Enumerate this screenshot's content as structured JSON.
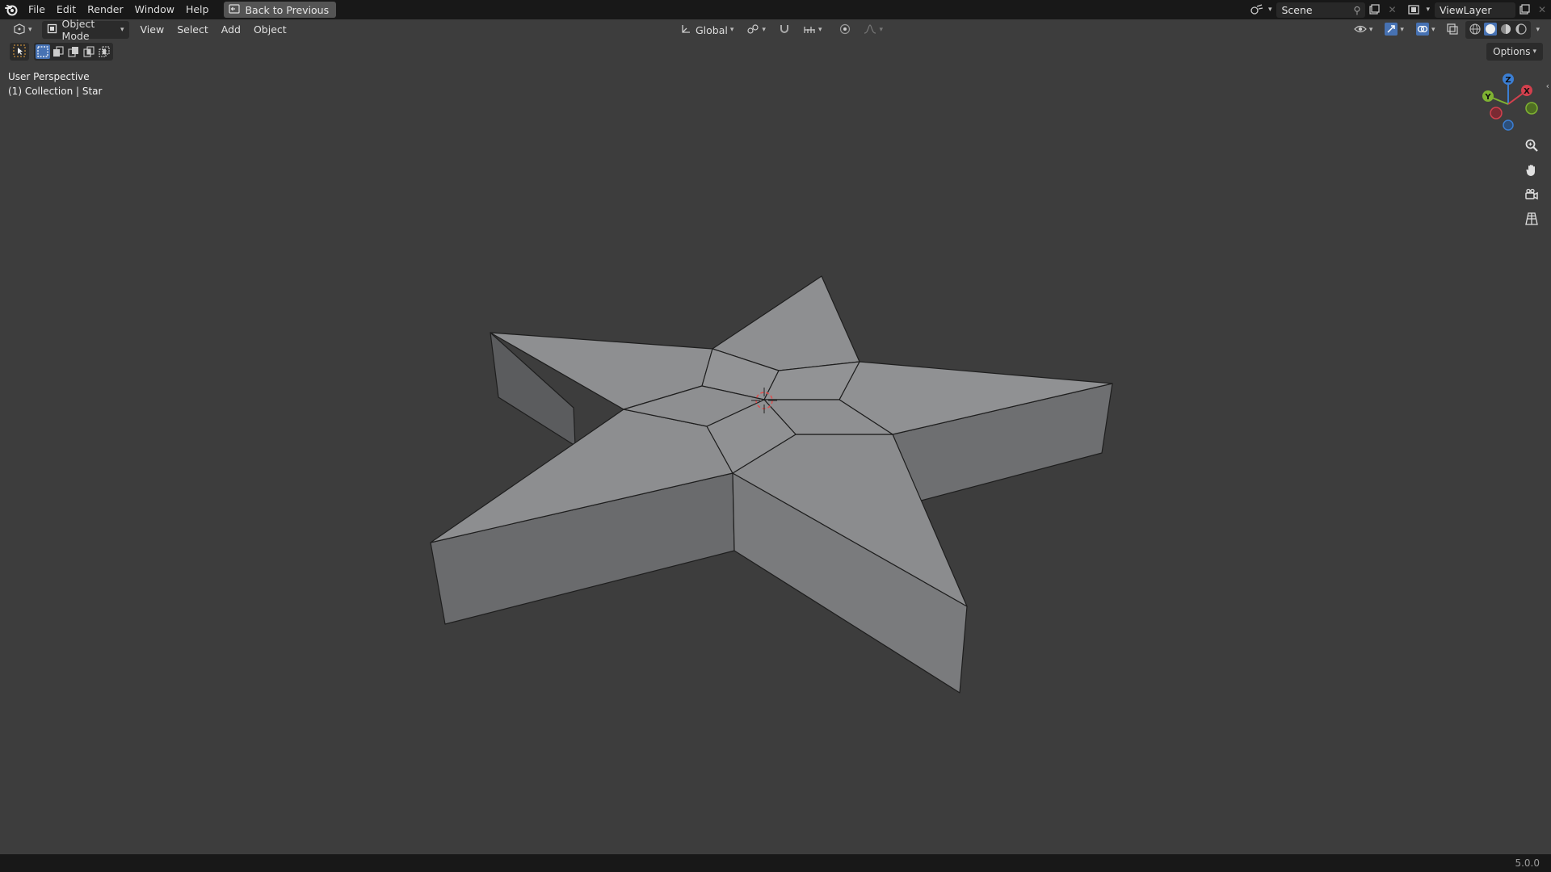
{
  "app": {
    "menu": [
      "File",
      "Edit",
      "Render",
      "Window",
      "Help"
    ],
    "back_button": "Back to Previous",
    "scene_name": "Scene",
    "view_layer": "ViewLayer"
  },
  "viewport_header": {
    "mode": "Object Mode",
    "menus": [
      "View",
      "Select",
      "Add",
      "Object"
    ],
    "transform_orientation": "Global"
  },
  "tool_settings": {
    "options_label": "Options"
  },
  "viewport": {
    "perspective_label": "User Perspective",
    "collection_label": "(1) Collection | Star",
    "gizmo_axes": {
      "x": "X",
      "y": "Y",
      "z": "Z"
    },
    "object_color": "#8f9092",
    "side_color": "#6d6e70"
  },
  "status": {
    "version": "5.0.0"
  },
  "colors": {
    "background": "#3d3d3d",
    "header": "#181818",
    "accent": "#4772b3",
    "axis_x": "#d3404d",
    "axis_y": "#7fb332",
    "axis_z": "#3b7ed3"
  }
}
